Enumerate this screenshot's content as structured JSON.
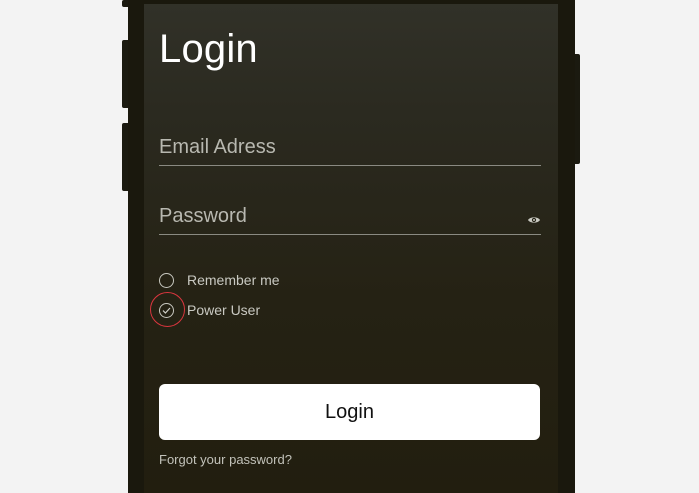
{
  "login": {
    "title": "Login",
    "email": {
      "placeholder": "Email Adress",
      "value": ""
    },
    "password": {
      "placeholder": "Password",
      "value": "",
      "toggle_icon": "eye-icon"
    },
    "options": [
      {
        "label": "Remember me",
        "checked": false
      },
      {
        "label": "Power User",
        "checked": true
      }
    ],
    "submit_label": "Login",
    "forgot_label": "Forgot your password?"
  },
  "colors": {
    "page_background": "#f3f3f3",
    "phone_frame": "#1a180d",
    "screen_top": "#313128",
    "screen_bottom": "#221e0f",
    "button_background": "#ffffff",
    "highlight_ring": "#d9363e"
  }
}
